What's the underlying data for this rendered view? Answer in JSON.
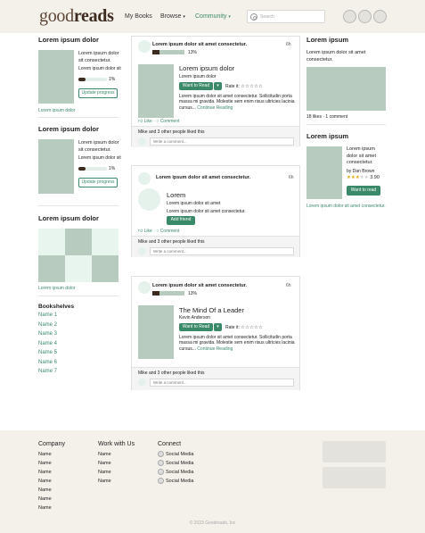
{
  "header": {
    "logo_light": "good",
    "logo_bold": "reads",
    "nav_mybooks": "My Books",
    "nav_browse": "Browse",
    "nav_community": "Community",
    "search_placeholder": "Search"
  },
  "left": {
    "progress1": {
      "heading": "Lorem ipsum dolor",
      "title": "Lorem ipsum dolor sit consectetur.",
      "subtitle": "Lorem ipsum dolor sit",
      "percent_label": "1%",
      "percent_value": 1,
      "button": "Update progress",
      "link": "Lorem ipsum dolor"
    },
    "progress2": {
      "heading": "Lorem ipsum dolor",
      "title": "Lorem ipsum dolor sit consectetur.",
      "subtitle": "Lorem ipsum dolor sit",
      "percent_label": "1%",
      "percent_value": 1,
      "button": "Update progress"
    },
    "grid": {
      "heading": "Lorem ipsum dolor",
      "link": "Lorem ipsum dolor"
    },
    "bookshelves": {
      "heading": "Bookshelves",
      "items": [
        "Name 1",
        "Name 2",
        "Name 3",
        "Name 4",
        "Name 5",
        "Name 6",
        "Name 7"
      ]
    }
  },
  "feed": {
    "card1": {
      "title": "Lorem ipsum dolor sit amet consectetur.",
      "time": "6h",
      "percent_label": "13%",
      "percent_value": 13,
      "book_title": "Lorem ipsum dolor",
      "book_sub": "Lorem ipsum dolor",
      "want": "Want to Read",
      "rate": "Rate it:",
      "stars": "☆☆☆☆☆",
      "desc": "Lorem ipsum dolor sit amet consectetur. Sollicitudin porta massa mi gravida. Molestie sem enim risus ultricies lacinia cursus...",
      "continue": "Continue Reading",
      "like": "Like",
      "comment": "Comment",
      "liked": "Mike and 3 other people liked this",
      "write": "Write a comment..."
    },
    "card2": {
      "title": "Lorem ipsum dolor sit amet consectetur.",
      "time": "6h",
      "name": "Lorem",
      "line1": "Lorem ipsum dolor sit amet",
      "line2": "Lorem ipsum dolor sit amet consectetur.",
      "add": "Add friend",
      "like": "Like",
      "comment": "Comment",
      "liked": "Mike and 3 other people liked this",
      "write": "Write a comment..."
    },
    "card3": {
      "title": "Lorem ipsum dolor sit amet consectetur.",
      "time": "6h",
      "percent_label": "13%",
      "percent_value": 13,
      "book_title": "The Mind Of a Leader",
      "author": "Kevin Anderson",
      "want": "Want to Read",
      "rate": "Rate it:",
      "stars": "☆☆☆☆☆",
      "desc": "Lorem ipsum dolor sit amet consectetur. Sollicitudin porta massa mi gravida. Molestie sem enim risus ultricies lacinia cursus...",
      "continue": "Continue Reading",
      "liked": "Mike and 3 other people liked this",
      "write": "Write a comment..."
    }
  },
  "right": {
    "section1": {
      "heading": "Lorem ipsum",
      "text": "Lorem ipsum dolor sit amet consectetur.",
      "stats": "18 likes · 1 comment"
    },
    "section2": {
      "heading": "Lorem ipsum",
      "title": "Lorem ipsum dolor sit amet consectetur.",
      "author": "by Dan Brown",
      "stars_filled": "★★★",
      "stars_empty": "★★",
      "rating": "3.90",
      "rating_value": 3.9,
      "button": "Want to read",
      "link": "Lorem ipsum dolor sit amet consectetur."
    }
  },
  "footer": {
    "company": {
      "heading": "Company",
      "items": [
        "Name",
        "Name",
        "Name",
        "Name",
        "Name",
        "Name",
        "Name"
      ]
    },
    "work": {
      "heading": "Work with Us",
      "items": [
        "Name",
        "Name",
        "Name",
        "Name"
      ]
    },
    "connect": {
      "heading": "Connect",
      "items": [
        "Social Media",
        "Social Media",
        "Social Media",
        "Social Media"
      ]
    },
    "copyright": "© 2023 Goodreads, Inc"
  },
  "colors": {
    "accent": "#3a8a6a",
    "header_bg": "#f4f1ea",
    "placeholder": "#b8cbbf",
    "dark_brown": "#3d2b1f"
  }
}
